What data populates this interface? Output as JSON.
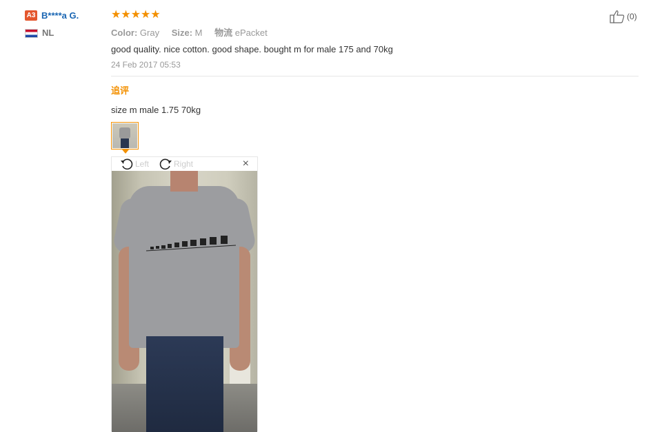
{
  "reviewer": {
    "level_badge": "A3",
    "name": "B****a G.",
    "country": "NL"
  },
  "review": {
    "stars": "★★★★★",
    "color_label": "Color:",
    "color_value": "Gray",
    "size_label": "Size:",
    "size_value": "M",
    "shipping_label": "物流",
    "shipping_value": "ePacket",
    "text": "good quality. nice cotton. good shape. bought m for male 175 and 70kg",
    "date": "24 Feb 2017 05:53",
    "helpful_count": "(0)"
  },
  "additional": {
    "label": "追评",
    "text": "size m male 1.75 70kg"
  },
  "viewer": {
    "rotate_left_label": "Left",
    "rotate_right_label": "Right",
    "close_glyph": "×"
  },
  "icons": {
    "thumbs_up": "thumbs-up-icon",
    "rotate_left": "rotate-left-icon",
    "rotate_right": "rotate-right-icon",
    "close": "close-icon",
    "flag": "netherlands-flag-icon"
  },
  "colors": {
    "accent": "#f39000",
    "name": "#1a66b3",
    "badge": "#e4572e",
    "muted": "#999999"
  }
}
